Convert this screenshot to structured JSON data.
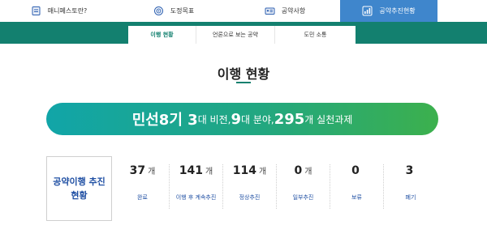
{
  "topnav": {
    "items": [
      {
        "label": "매니페스토란?",
        "icon": "document-icon"
      },
      {
        "label": "도정목표",
        "icon": "target-icon"
      },
      {
        "label": "공약사항",
        "icon": "id-card-icon"
      },
      {
        "label": "공약추진현황",
        "icon": "chart-icon",
        "active": true
      }
    ]
  },
  "subtabs": [
    {
      "label": "이행 현황",
      "active": true
    },
    {
      "label": "언론으로 보는 공약"
    },
    {
      "label": "도민 소통"
    }
  ],
  "page": {
    "title": "이행 현황"
  },
  "banner": {
    "part1": "민선8기 3",
    "part2": "대 비전, ",
    "part3": "9",
    "part4": "대 분야, ",
    "part5": "295",
    "part6": "개 실천과제"
  },
  "status_box": {
    "label": "공약이행 추진\n현황"
  },
  "stats": [
    {
      "value": "37",
      "unit": "개",
      "label": "완료"
    },
    {
      "value": "141",
      "unit": "개",
      "label": "이행 후 계속추진"
    },
    {
      "value": "114",
      "unit": "개",
      "label": "정상추진"
    },
    {
      "value": "0",
      "unit": "개",
      "label": "일부추진"
    },
    {
      "value": "0",
      "unit": "",
      "label": "보류"
    },
    {
      "value": "3",
      "unit": "",
      "label": "폐기"
    }
  ],
  "colors": {
    "accent_green": "#13806f",
    "active_tab_blue": "#3f86cc",
    "label_blue": "#1f4fa3"
  }
}
